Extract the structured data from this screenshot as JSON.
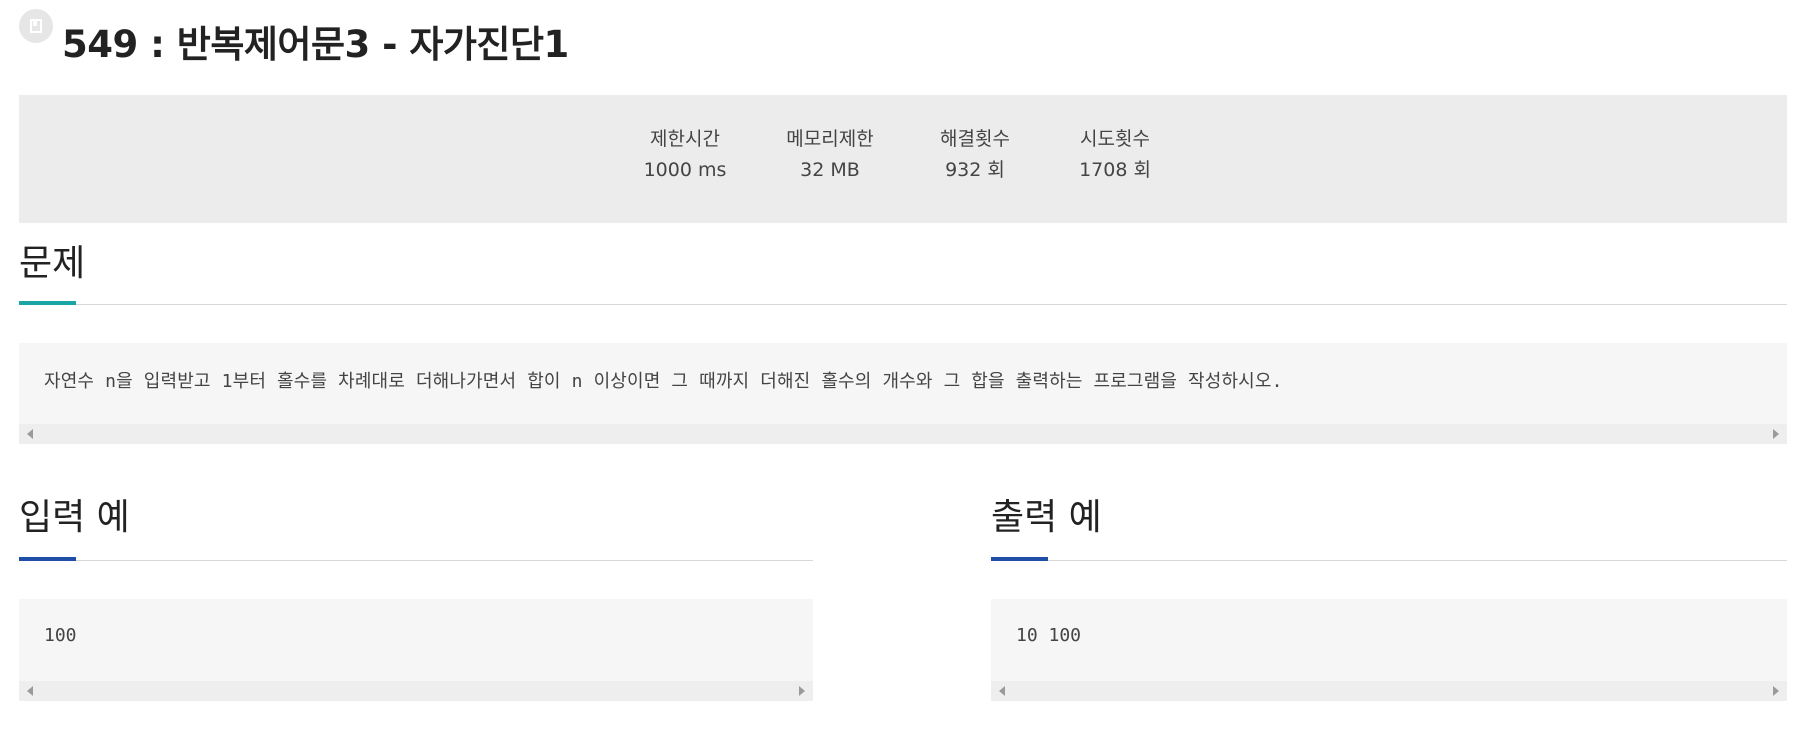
{
  "problem": {
    "title": "549 : 반복제어문3 - 자가진단1"
  },
  "stats": [
    {
      "label": "제한시간",
      "value": "1000 ms"
    },
    {
      "label": "메모리제한",
      "value": "32 MB"
    },
    {
      "label": "해결횟수",
      "value": "932 회"
    },
    {
      "label": "시도횟수",
      "value": "1708 회"
    }
  ],
  "sections": {
    "problem_heading": "문제",
    "problem_text": "자연수 n을 입력받고 1부터 홀수를 차례대로 더해나가면서 합이 n 이상이면 그 때까지 더해진 홀수의 개수와 그 합을 출력하는 프로그램을 작성하시오.",
    "input_heading": "입력 예",
    "input_text": "100",
    "output_heading": "출력 예",
    "output_text": "10 100"
  },
  "colors": {
    "problem_accent": "#1aa6a6",
    "sample_accent": "#1f4ea6",
    "stats_background": "#ececec",
    "code_background": "#f6f6f7"
  },
  "icons": {
    "title_icon": "document-icon"
  }
}
